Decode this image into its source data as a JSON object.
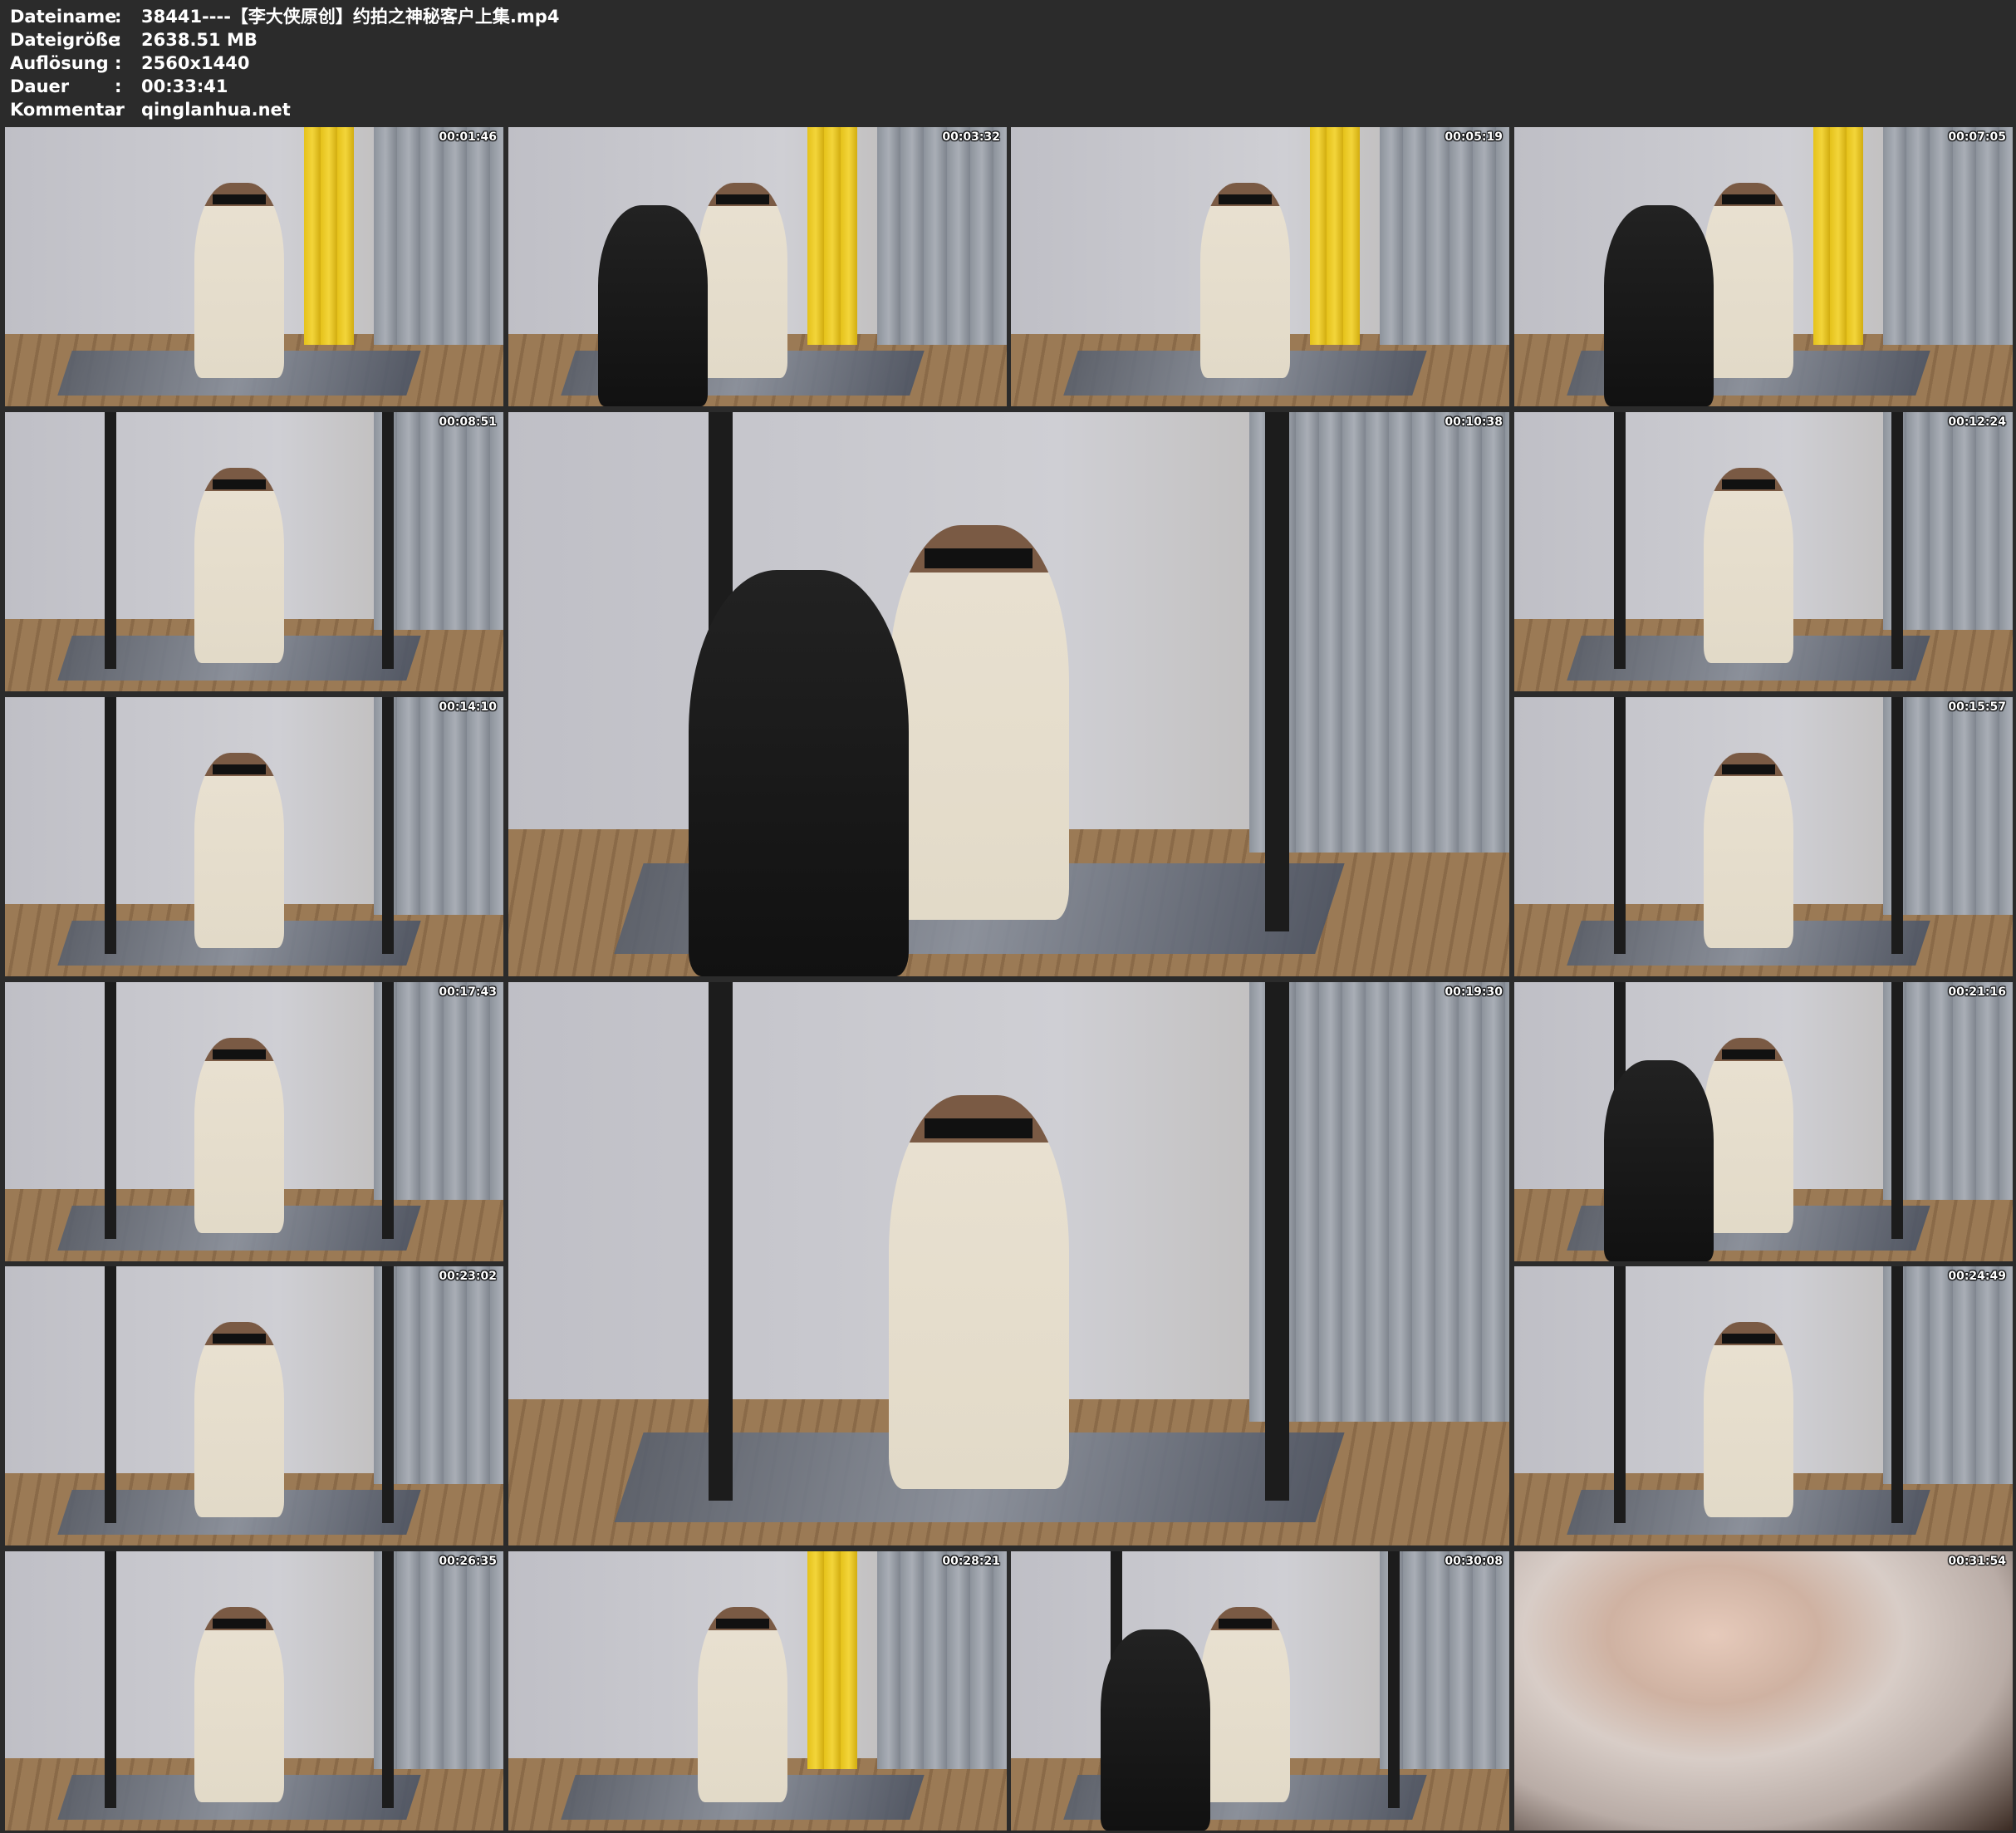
{
  "info": [
    {
      "key": "Dateiname",
      "sep": ":",
      "value": "38441----【李大侠原创】约拍之神秘客户上集.mp4"
    },
    {
      "key": "Dateigröße",
      "sep": ":",
      "value": "2638.51 MB"
    },
    {
      "key": "Auflösung",
      "sep": ":",
      "value": "2560x1440"
    },
    {
      "key": "Dauer",
      "sep": ":",
      "value": "00:33:41"
    },
    {
      "key": "Kommentar",
      "sep": ":",
      "value": "qinglanhua.net"
    }
  ],
  "thumbnails": [
    {
      "timestamp": "00:01:46",
      "scene": "standing-curtain"
    },
    {
      "timestamp": "00:03:32",
      "scene": "two-people-curtain"
    },
    {
      "timestamp": "00:05:19",
      "scene": "standing-back-curtain"
    },
    {
      "timestamp": "00:07:05",
      "scene": "two-people-curtain"
    },
    {
      "timestamp": "00:08:51",
      "scene": "kneeling-cage"
    },
    {
      "timestamp": "00:10:38",
      "scene": "kneeling-two-people-large"
    },
    {
      "timestamp": "00:12:24",
      "scene": "kneeling-frame"
    },
    {
      "timestamp": "00:14:10",
      "scene": "kneeling-frame"
    },
    {
      "timestamp": "00:15:57",
      "scene": "kneeling-frame"
    },
    {
      "timestamp": "00:17:43",
      "scene": "kneeling-frame"
    },
    {
      "timestamp": "00:19:30",
      "scene": "kneeling-large"
    },
    {
      "timestamp": "00:21:16",
      "scene": "two-people-frame"
    },
    {
      "timestamp": "00:23:02",
      "scene": "kneeling-frame"
    },
    {
      "timestamp": "00:24:49",
      "scene": "kneeling-cage"
    },
    {
      "timestamp": "00:26:35",
      "scene": "kneeling-frame"
    },
    {
      "timestamp": "00:28:21",
      "scene": "kneeling-curtain"
    },
    {
      "timestamp": "00:30:08",
      "scene": "two-people-frame"
    },
    {
      "timestamp": "00:31:54",
      "scene": "closeup"
    }
  ]
}
